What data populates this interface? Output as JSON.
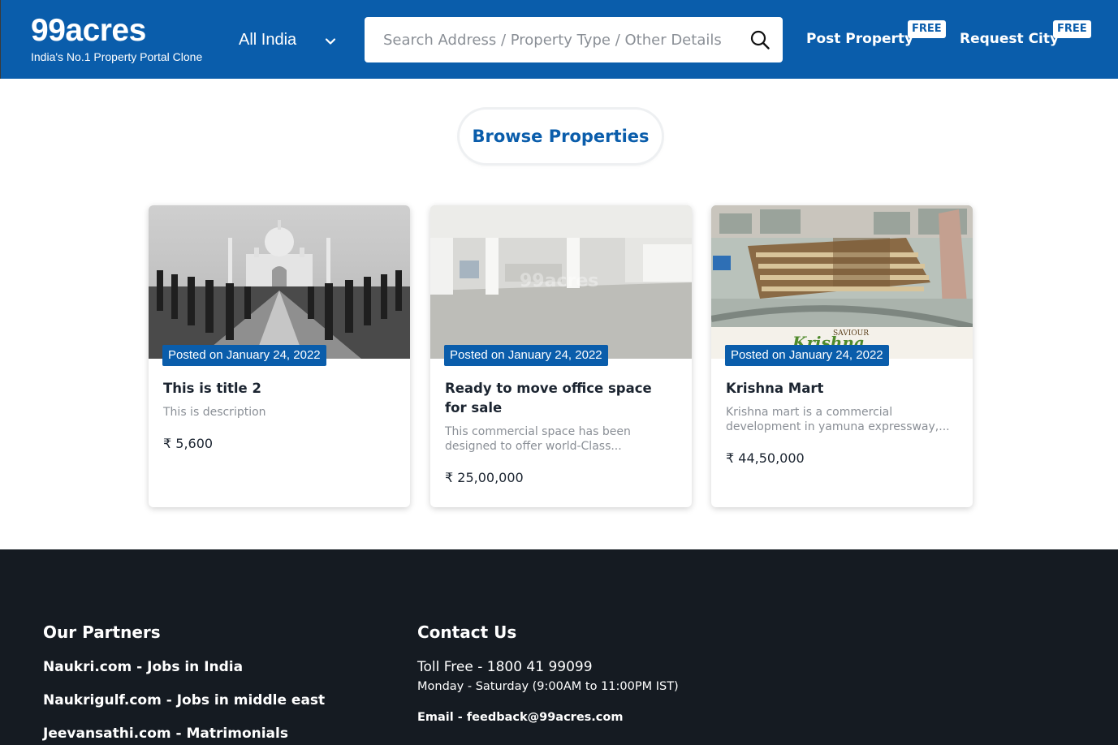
{
  "header": {
    "logo_title": "99acres",
    "logo_subtitle": "India's No.1 Property Portal Clone",
    "city_selector": "All India",
    "search_placeholder": "Search Address / Property Type / Other Details",
    "post_property": "Post Property",
    "post_property_badge": "FREE",
    "request_city": "Request City",
    "request_city_badge": "FREE"
  },
  "main": {
    "browse_button": "Browse Properties",
    "cards": [
      {
        "posted": "Posted on January 24, 2022",
        "title": "This is title 2",
        "description": "This is description",
        "price": "₹ 5,600"
      },
      {
        "posted": "Posted on January 24, 2022",
        "title": "Ready to move office space for sale",
        "description": "This commercial space has been designed to offer world-Class...",
        "price": "₹ 25,00,000"
      },
      {
        "posted": "Posted on January 24, 2022",
        "title": "Krishna Mart",
        "description": "Krishna mart is a commercial development in yamuna expressway,...",
        "price": "₹ 44,50,000"
      }
    ]
  },
  "footer": {
    "partners_heading": "Our Partners",
    "partners": [
      "Naukri.com - Jobs in India",
      "Naukrigulf.com - Jobs in middle east",
      "Jeevansathi.com - Matrimonials"
    ],
    "contact_heading": "Contact Us",
    "toll_free": "Toll Free - 1800 41 99099",
    "hours": "Monday - Saturday (9:00AM to 11:00PM IST)",
    "email": "Email - feedback@99acres.com"
  },
  "colors": {
    "brand": "#0a5dab",
    "footer_bg": "#151b22"
  }
}
